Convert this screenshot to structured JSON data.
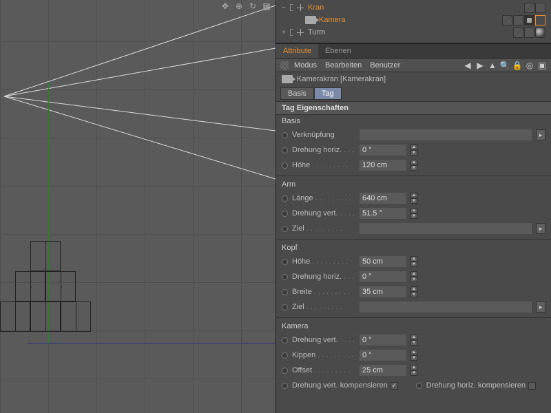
{
  "outliner": {
    "items": [
      {
        "name": "Kran",
        "selected": true,
        "expander": "−",
        "indent": 0,
        "icon": "null"
      },
      {
        "name": "Kamera",
        "selected": true,
        "expander": "",
        "indent": 1,
        "icon": "cam"
      },
      {
        "name": "Turm",
        "selected": false,
        "expander": "+",
        "indent": 0,
        "icon": "null"
      }
    ]
  },
  "tabs": {
    "active": "Attribute",
    "other": "Ebenen"
  },
  "menubar": {
    "modus": "Modus",
    "bearbeiten": "Bearbeiten",
    "benutzer": "Benutzer"
  },
  "obj": {
    "title": "Kamerakran [Kamerakran]"
  },
  "subtabs": {
    "basis": "Basis",
    "tag": "Tag"
  },
  "section_title": "Tag Eigenschaften",
  "groups": {
    "basis": {
      "title": "Basis",
      "verknupfung": {
        "label": "Verknüpfung"
      },
      "drehung_horiz": {
        "label": "Drehung horiz.",
        "value": "0 °"
      },
      "hoehe": {
        "label": "Höhe",
        "value": "120 cm"
      }
    },
    "arm": {
      "title": "Arm",
      "laenge": {
        "label": "Länge",
        "value": "640 cm"
      },
      "drehung_vert": {
        "label": "Drehung vert.",
        "value": "51.5 °"
      },
      "ziel": {
        "label": "Ziel"
      }
    },
    "kopf": {
      "title": "Kopf",
      "hoehe": {
        "label": "Höhe",
        "value": "50 cm"
      },
      "drehung_horiz": {
        "label": "Drehung horiz.",
        "value": "0 °"
      },
      "breite": {
        "label": "Breite",
        "value": "35 cm"
      },
      "ziel": {
        "label": "Ziel"
      }
    },
    "kamera": {
      "title": "Kamera",
      "drehung_vert": {
        "label": "Drehung vert.",
        "value": "0 °"
      },
      "kippen": {
        "label": "Kippen",
        "value": "0 °"
      },
      "offset": {
        "label": "Offset",
        "value": "25 cm"
      },
      "comp_v": {
        "label": "Drehung vert. kompensieren",
        "checked": true
      },
      "comp_h": {
        "label": "Drehung horiz. kompensieren",
        "checked": false
      }
    }
  }
}
